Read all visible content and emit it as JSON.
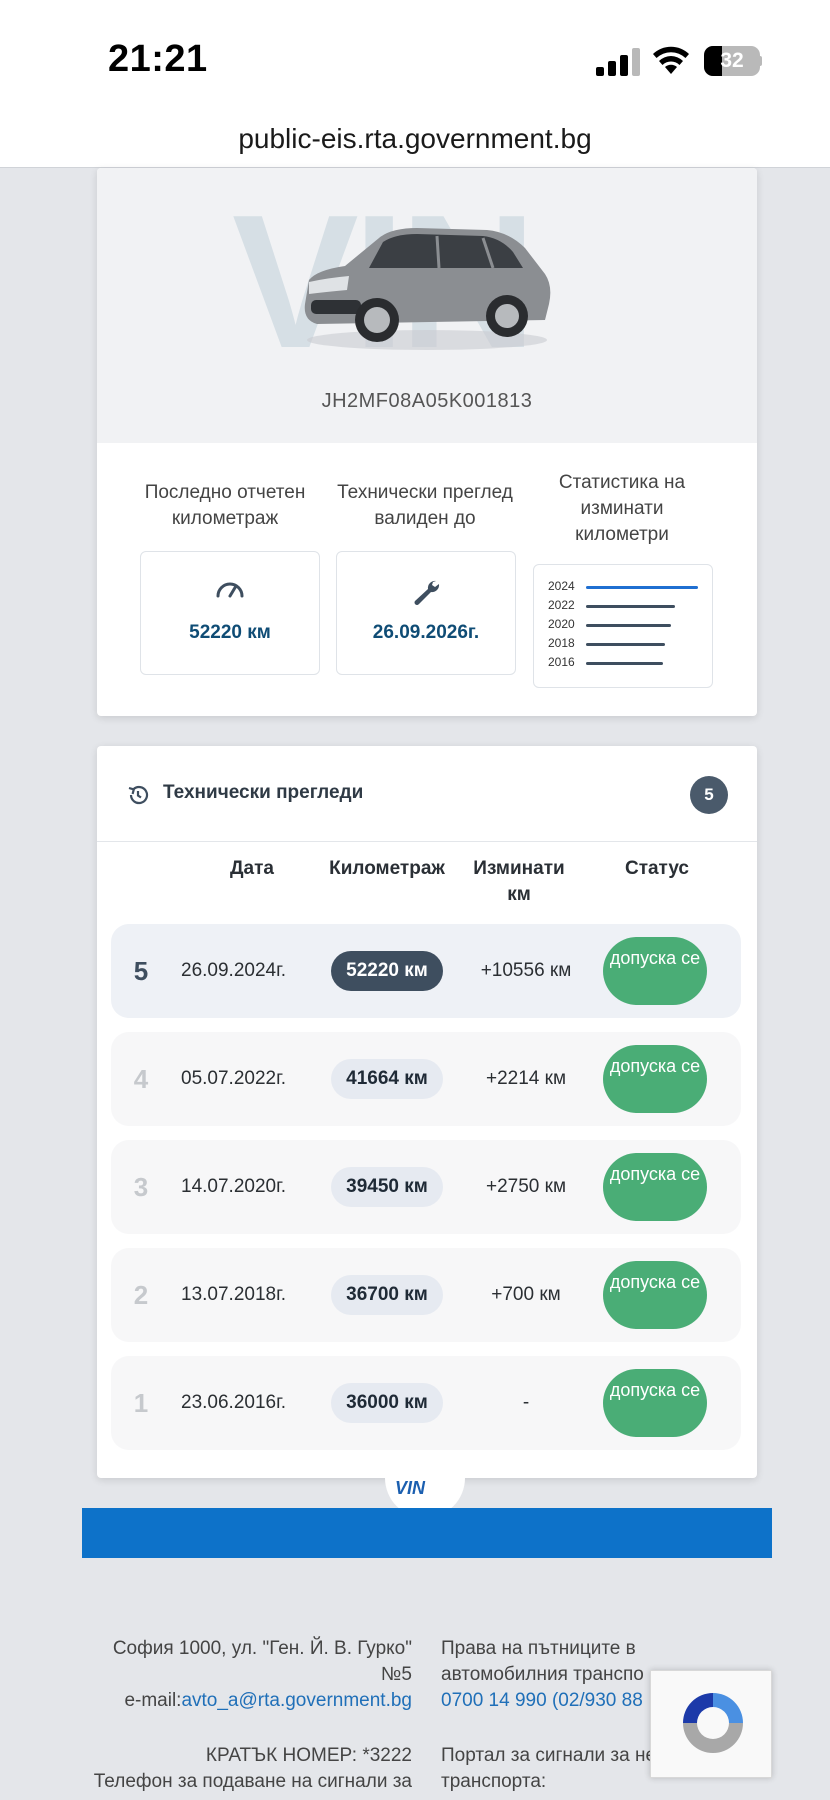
{
  "status_bar": {
    "time": "21:21",
    "battery": "32",
    "icons": [
      "signal-icon",
      "wifi-icon",
      "battery-icon"
    ]
  },
  "browser": {
    "url": "public-eis.rta.government.bg"
  },
  "vehicle": {
    "vin_watermark": "VIN",
    "vin": "JH2MF08A05K001813",
    "stats": {
      "mileage_label": "Последно отчетен километраж",
      "mileage_value": "52220 км",
      "inspection_label": "Технически преглед валиден до",
      "inspection_value": "26.09.2026г.",
      "chart_label": "Статистика на изминати километри",
      "chart_years": [
        "2024",
        "2022",
        "2020",
        "2018",
        "2016"
      ]
    }
  },
  "chart_data": {
    "type": "bar",
    "categories": [
      "2024",
      "2022",
      "2020",
      "2018",
      "2016"
    ],
    "values": [
      52220,
      41664,
      39450,
      36700,
      36000
    ],
    "title": "Статистика на изминати километри"
  },
  "inspections": {
    "title": "Технически прегледи",
    "count": "5",
    "columns": {
      "date": "Дата",
      "km": "Километраж",
      "diff": "Изминати км",
      "status": "Статус"
    },
    "rows": [
      {
        "num": "5",
        "date": "26.09.2024г.",
        "km": "52220 км",
        "diff": "+10556 км",
        "status": "допуска се"
      },
      {
        "num": "4",
        "date": "05.07.2022г.",
        "km": "41664 км",
        "diff": "+2214 км",
        "status": "допуска се"
      },
      {
        "num": "3",
        "date": "14.07.2020г.",
        "km": "39450 км",
        "diff": "+2750 км",
        "status": "допуска се"
      },
      {
        "num": "2",
        "date": "13.07.2018г.",
        "km": "36700 км",
        "diff": "+700 км",
        "status": "допуска се"
      },
      {
        "num": "1",
        "date": "23.06.2016г.",
        "km": "36000 км",
        "diff": "-",
        "status": "допуска се"
      }
    ]
  },
  "footer": {
    "logo": "VIN",
    "address_line1": "София 1000, ул. \"Ген. Й. В. Гурко\"",
    "address_line2": "№5",
    "email_prefix": "e-mail:",
    "email": "avto_a@rta.government.bg",
    "short_number": "КРАТЪК НОМЕР: *3222",
    "phone_label": "Телефон за подаване на сигнали за",
    "rights_line1": "Права на пътниците в",
    "rights_line2": "автомобилния транспо",
    "rights_phone": "0700 14 990 (02/930 88",
    "portal_line1": "Портал за сигнали за не",
    "portal_line2": "транспорта:"
  }
}
